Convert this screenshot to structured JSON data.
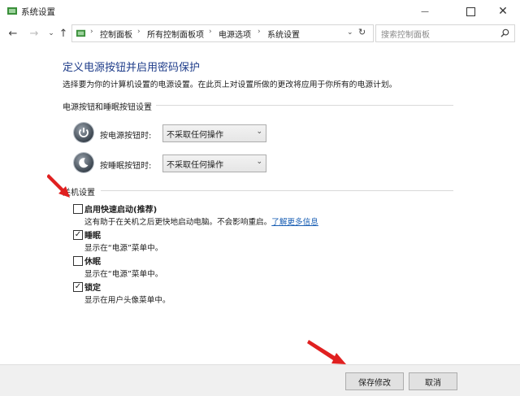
{
  "window": {
    "title": "系统设置"
  },
  "address": {
    "crumbs": [
      "控制面板",
      "所有控制面板项",
      "电源选项",
      "系统设置"
    ],
    "search_placeholder": "搜索控制面板"
  },
  "page": {
    "heading": "定义电源按钮并启用密码保护",
    "description": "选择要为你的计算机设置的电源设置。在此页上对设置所做的更改将应用于你所有的电源计划。"
  },
  "buttons_section": {
    "label": "电源按钮和睡眠按钮设置",
    "power": {
      "label": "按电源按钮时:",
      "value": "不采取任何操作"
    },
    "sleep": {
      "label": "按睡眠按钮时:",
      "value": "不采取任何操作"
    }
  },
  "shutdown_section": {
    "label": "关机设置",
    "items": [
      {
        "label": "启用快速启动(推荐)",
        "checked": false,
        "desc": "这有助于在关机之后更快地启动电脑。不会影响重启。",
        "link": "了解更多信息"
      },
      {
        "label": "睡眠",
        "checked": true,
        "desc": "显示在“电源”菜单中。"
      },
      {
        "label": "休眠",
        "checked": false,
        "desc": "显示在“电源”菜单中。"
      },
      {
        "label": "锁定",
        "checked": true,
        "desc": "显示在用户头像菜单中。"
      }
    ]
  },
  "footer": {
    "save": "保存修改",
    "cancel": "取消"
  },
  "colors": {
    "heading": "#1f3d8a",
    "link": "#1a5fb4",
    "annotation_arrow": "#e02020"
  }
}
